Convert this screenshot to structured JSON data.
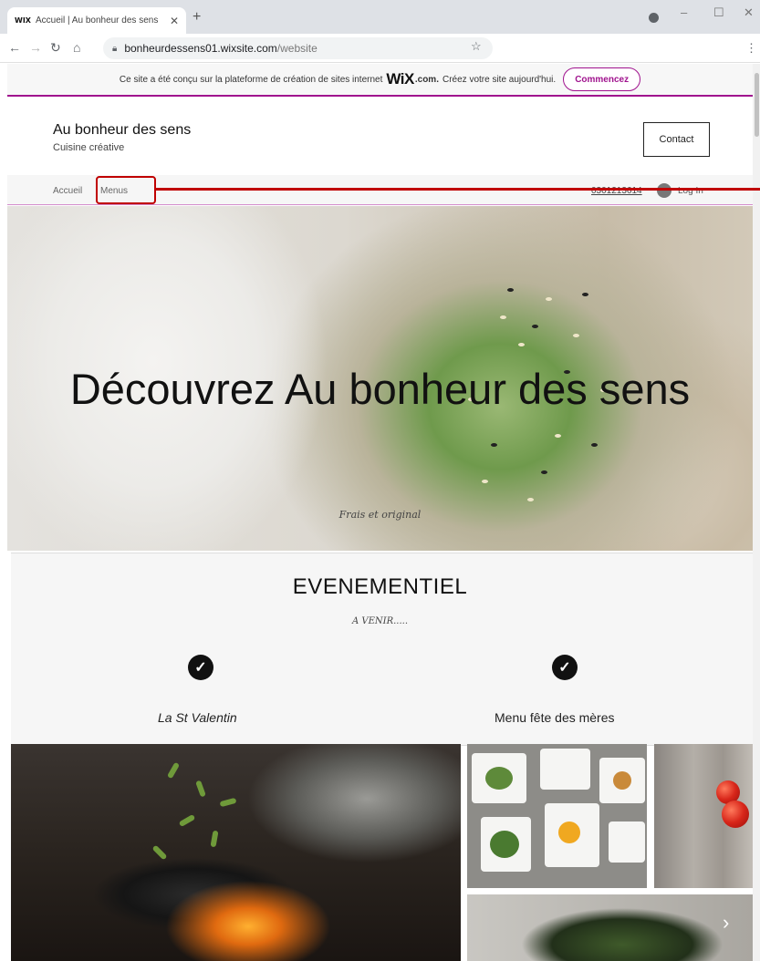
{
  "browser": {
    "tab_favicon": "WIX",
    "tab_title": "Accueil | Au bonheur des sens",
    "tab_close": "✕",
    "new_tab": "+",
    "url_host": "bonheurdessens01.wixsite.com",
    "url_path": "/website",
    "window_controls": [
      "–",
      "☐",
      "✕"
    ]
  },
  "wix_banner": {
    "text": "Ce site a été conçu sur la plateforme de création de sites internet",
    "logo": "WiX",
    "dotcom": ".com.",
    "cta_text": "Créez votre site aujourd'hui.",
    "button": "Commencez",
    "accent_color": "#a0138e"
  },
  "site": {
    "title": "Au bonheur des sens",
    "tagline": "Cuisine créative",
    "contact_button": "Contact",
    "menu": [
      {
        "label": "Accueil"
      },
      {
        "label": "Menus"
      }
    ],
    "phone": "0301213614",
    "login": "Log In"
  },
  "hero": {
    "title": "Découvrez Au bonheur des sens",
    "subtitle": "Frais et original"
  },
  "events": {
    "title": "EVENEMENTIEL",
    "subtitle": "A VENIR.....",
    "items": [
      {
        "label": "La St Valentin",
        "icon": "check-icon"
      },
      {
        "label": "Menu fête des mères",
        "icon": "check-icon"
      }
    ]
  },
  "annotation_color": "#c00000"
}
